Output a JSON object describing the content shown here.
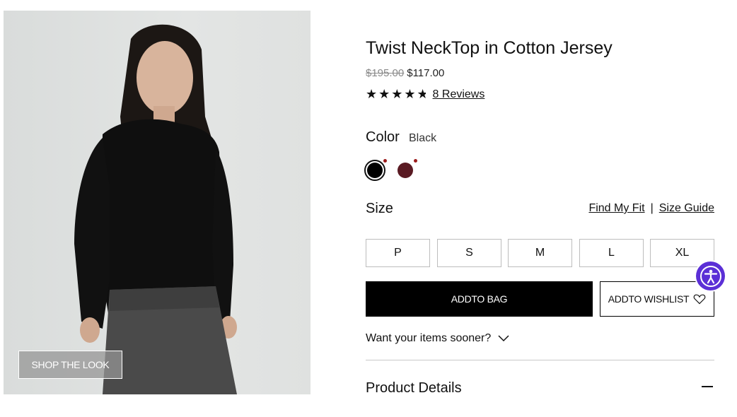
{
  "product": {
    "title": "Twist NeckTop in Cotton Jersey",
    "original_price": "$195.00",
    "sale_price": "$117.00",
    "stars": "★★★★",
    "rating": 4.5,
    "reviews_label": "8 Reviews"
  },
  "image": {
    "shop_the_look_label": "SHOP THE LOOK"
  },
  "color": {
    "label": "Color",
    "selected": "Black",
    "swatches": [
      {
        "name": "black",
        "hex": "#000000",
        "selected": true
      },
      {
        "name": "burgundy",
        "hex": "#5a1a23",
        "selected": false
      }
    ]
  },
  "size": {
    "label": "Size",
    "find_my_fit": "Find My Fit",
    "separator": "|",
    "size_guide": "Size Guide",
    "options": [
      "P",
      "S",
      "M",
      "L",
      "XL"
    ]
  },
  "actions": {
    "add_to_bag": "ADDTO BAG",
    "add_to_wishlist": "ADDTO WISHLIST"
  },
  "delivery": {
    "sooner_label": "Want your items sooner?"
  },
  "sections": {
    "product_details": "Product Details"
  },
  "accessibility": {
    "icon": "accessibility-icon",
    "color": "#5b2fd6"
  }
}
